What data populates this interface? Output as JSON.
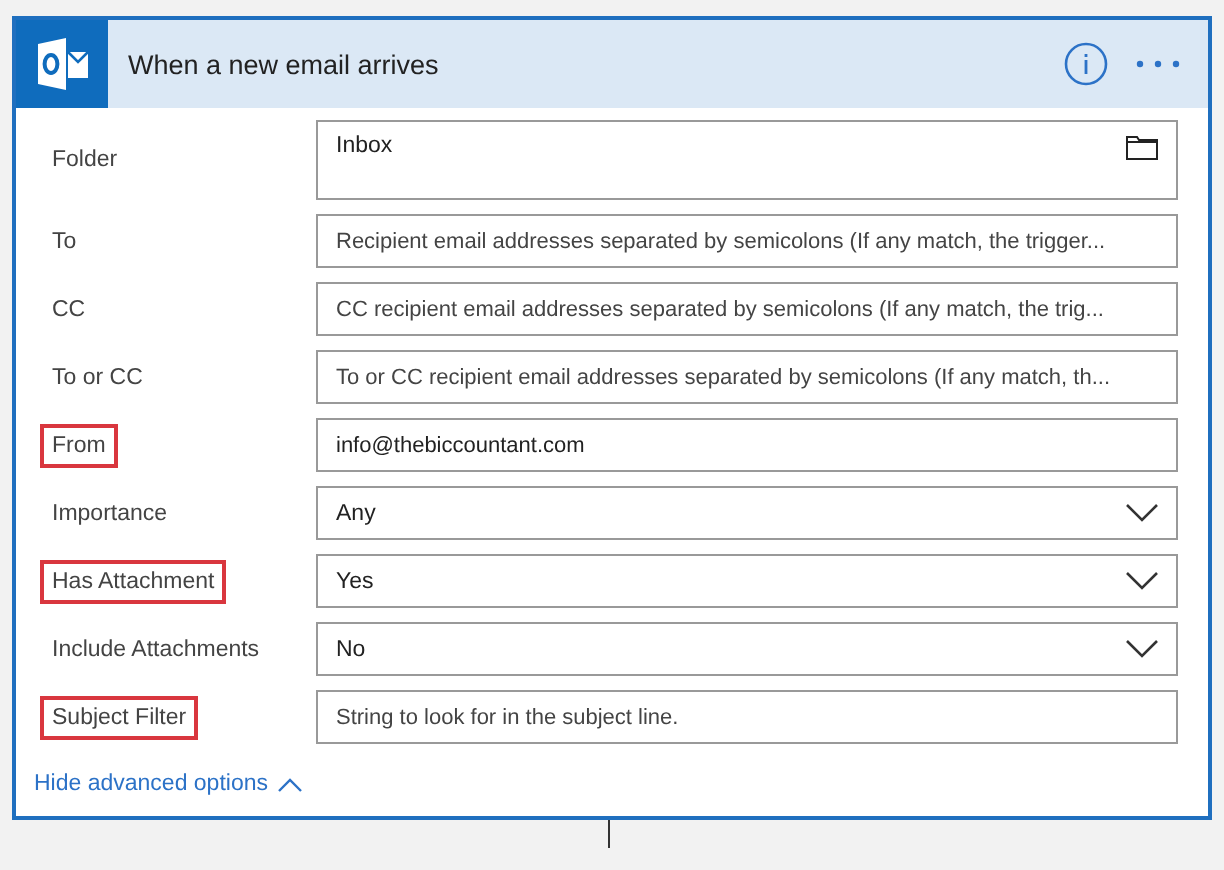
{
  "card": {
    "title": "When a new email arrives"
  },
  "fields": [
    {
      "label": "Folder",
      "kind": "folder",
      "value": "Inbox",
      "highlighted": false
    },
    {
      "label": "To",
      "kind": "text",
      "placeholder": "Recipient email addresses separated by semicolons (If any match, the trigger...",
      "highlighted": false
    },
    {
      "label": "CC",
      "kind": "text",
      "placeholder": "CC recipient email addresses separated by semicolons (If any match, the trig...",
      "highlighted": false
    },
    {
      "label": "To or CC",
      "kind": "text",
      "placeholder": "To or CC recipient email addresses separated by semicolons (If any match, th...",
      "highlighted": false
    },
    {
      "label": "From",
      "kind": "text",
      "value": "info@thebiccountant.com",
      "highlighted": true
    },
    {
      "label": "Importance",
      "kind": "dropdown",
      "value": "Any",
      "highlighted": false
    },
    {
      "label": "Has Attachment",
      "kind": "dropdown",
      "value": "Yes",
      "highlighted": true
    },
    {
      "label": "Include Attachments",
      "kind": "dropdown",
      "value": "No",
      "highlighted": false
    },
    {
      "label": "Subject Filter",
      "kind": "text",
      "placeholder": "String to look for in the subject line.",
      "highlighted": true
    }
  ],
  "advanced_toggle": {
    "label": "Hide advanced options",
    "expanded": true
  }
}
